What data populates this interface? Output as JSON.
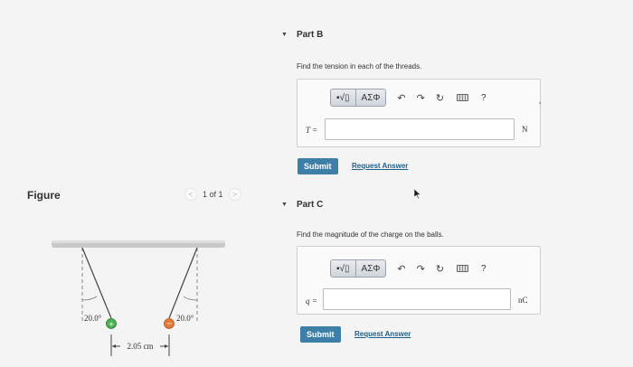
{
  "figure": {
    "label": "Figure",
    "pager": {
      "prev": "<",
      "text": "1 of 1",
      "next": ">"
    },
    "angle_left": "20.0°",
    "angle_right": "20.0°",
    "distance": "2.05 cm"
  },
  "partB": {
    "heading": "Part B",
    "prompt": "Find the tension in each of the threads.",
    "toolbar": {
      "templates": "▪√▯",
      "symbols": "ΑΣΦ",
      "help": "?"
    },
    "var_label": "T =",
    "unit": "N",
    "submit": "Submit",
    "request": "Request Answer",
    "comma": ","
  },
  "partC": {
    "heading": "Part C",
    "prompt": "Find the magnitude of the charge on the balls.",
    "toolbar": {
      "templates": "▪√▯",
      "symbols": "ΑΣΦ",
      "help": "?"
    },
    "var_label": "q =",
    "unit": "nC",
    "submit": "Submit",
    "request": "Request Answer"
  },
  "colors": {
    "submit": "#3e7fa8",
    "link": "#1e5f8b",
    "positive_charge": "#4caf50",
    "negative_charge": "#e07a3c"
  }
}
